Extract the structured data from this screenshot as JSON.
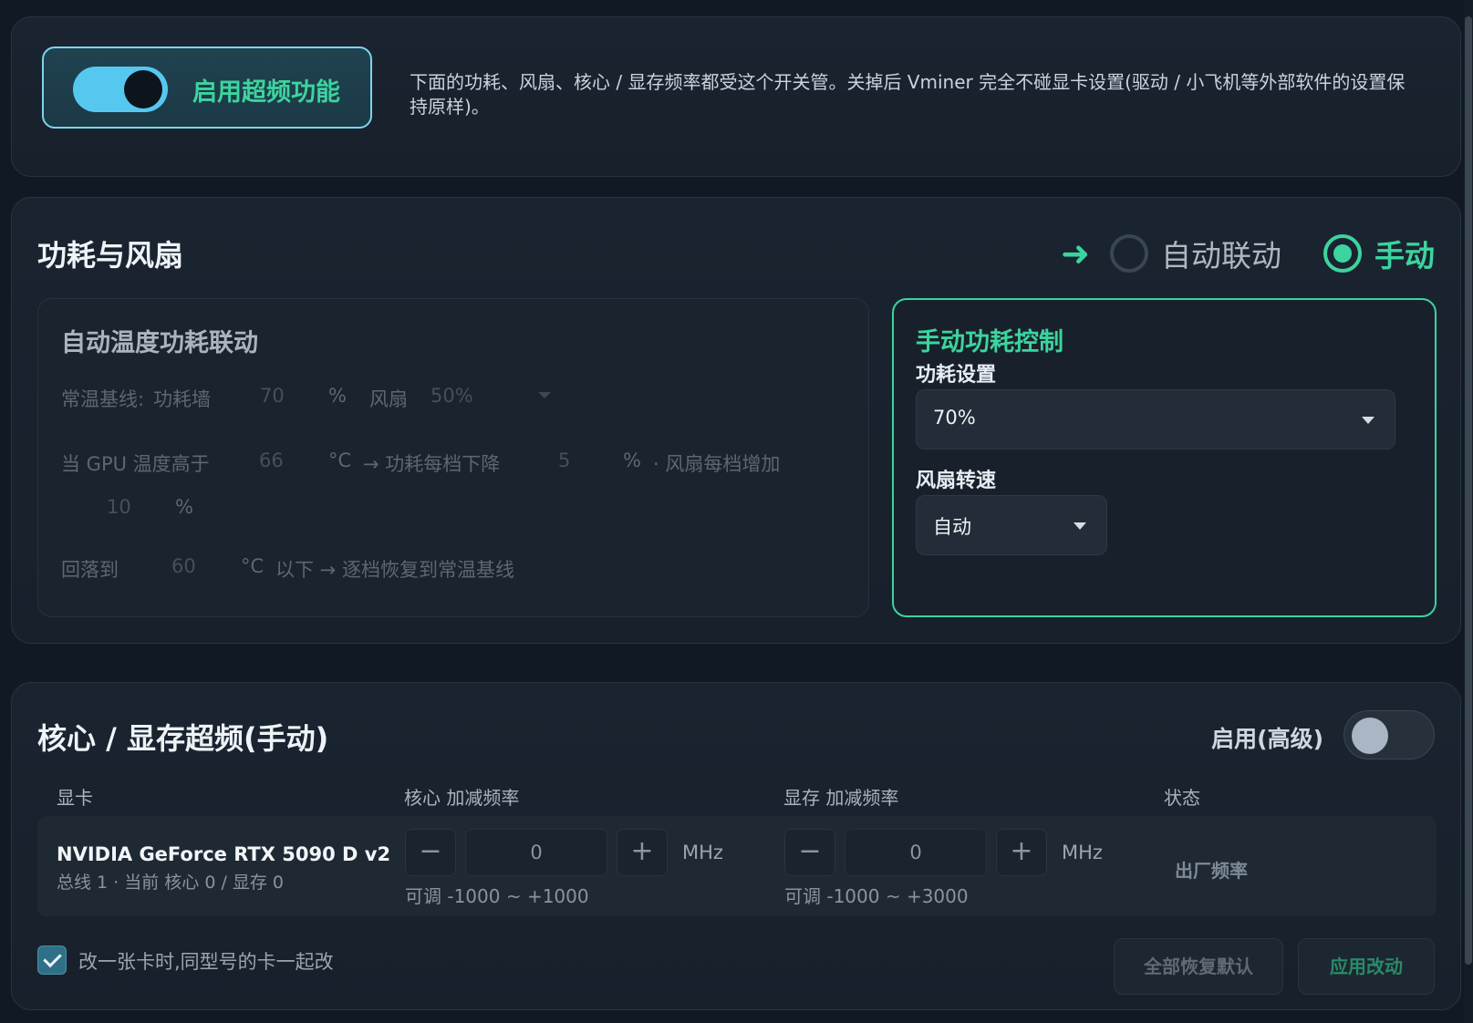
{
  "master": {
    "toggle_label": "启用超频功能",
    "toggle_on": true,
    "description": "下面的功耗、风扇、核心 / 显存频率都受这个开关管。关掉后 Vminer 完全不碰显卡设置(驱动 / 小飞机等外部软件的设置保持原样)。"
  },
  "power_fan": {
    "title": "功耗与风扇",
    "mode_options": [
      "自动联动",
      "手动"
    ],
    "selected_mode": "手动",
    "auto": {
      "title": "自动温度功耗联动",
      "baseline_label": "常温基线:",
      "power_wall_label": "功耗墙",
      "power_wall_value": "70",
      "percent": "%",
      "fan_label": "风扇",
      "fan_value": "50%",
      "temp_above_label": "当 GPU 温度高于",
      "temp_above_value": "66",
      "celsius": "°C",
      "power_drop_label": "→ 功耗每档下降",
      "power_drop_value": "5",
      "fan_inc_label": "· 风扇每档增加",
      "fan_inc_value": "10",
      "fallback_label": "回落到",
      "fallback_value": "60",
      "fallback_suffix": "以下 → 逐档恢复到常温基线"
    },
    "manual": {
      "title": "手动功耗控制",
      "power_label": "功耗设置",
      "power_value": "70%",
      "fan_label": "风扇转速",
      "fan_value": "自动"
    }
  },
  "oc": {
    "title": "核心 / 显存超频(手动)",
    "advanced_label": "启用(高级)",
    "advanced_on": false,
    "columns": [
      "显卡",
      "核心 加减频率",
      "显存 加减频率",
      "状态"
    ],
    "gpu": {
      "name": "NVIDIA GeForce RTX 5090 D v2",
      "sub": "总线 1 · 当前 核心 0 / 显存 0",
      "core_value": "0",
      "core_range": "可调 -1000 ~ +1000",
      "mem_value": "0",
      "mem_range": "可调 -1000 ~ +3000",
      "unit": "MHz",
      "minus": "−",
      "plus": "+",
      "status": "出厂频率"
    },
    "same_model_label": "改一张卡时,同型号的卡一起改",
    "same_model_checked": true,
    "reset_label": "全部恢复默认",
    "apply_label": "应用改动"
  },
  "colors": {
    "accent": "#3cd49e",
    "toggle": "#56c8f0"
  }
}
